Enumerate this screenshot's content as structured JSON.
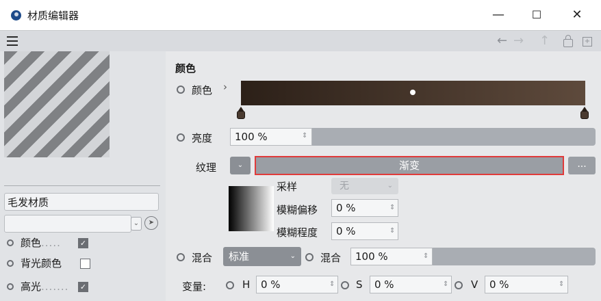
{
  "window": {
    "title": "材质编辑器",
    "minimize": "—",
    "maximize": "☐",
    "close": "✕"
  },
  "toolbar": {
    "back": "←",
    "forward": "→",
    "up": "↑"
  },
  "left": {
    "material_name": "毛发材质",
    "channels": [
      {
        "label": "颜色",
        "dots": ".....",
        "checked": true
      },
      {
        "label": "背光颜色",
        "dots": "",
        "checked": false
      },
      {
        "label": "高光",
        "dots": ".......",
        "checked": true
      }
    ]
  },
  "color_section": {
    "title": "颜色",
    "color_label": "颜色",
    "color_arrow": "›",
    "gradient_colors": [
      "#2c2018",
      "#5e4a3c"
    ],
    "brightness_label": "亮度",
    "brightness_value": "100 %",
    "texture_label": "纹理",
    "texture_value": "渐变",
    "more_label": "...",
    "sampling_label": "采样",
    "sampling_value": "无",
    "blur_offset_label": "模糊偏移",
    "blur_offset_value": "0 %",
    "blur_scale_label": "模糊程度",
    "blur_scale_value": "0 %",
    "mix_mode_label": "混合",
    "mix_mode_value": "标准",
    "mix_strength_label": "混合",
    "mix_strength_value": "100 %",
    "variation_label": "变量:",
    "h_label": "H",
    "h_value": "0 %",
    "s_label": "S",
    "s_value": "0 %",
    "v_label": "V",
    "v_value": "0 %"
  },
  "accent": {
    "highlight_border": "#e03a3a"
  }
}
